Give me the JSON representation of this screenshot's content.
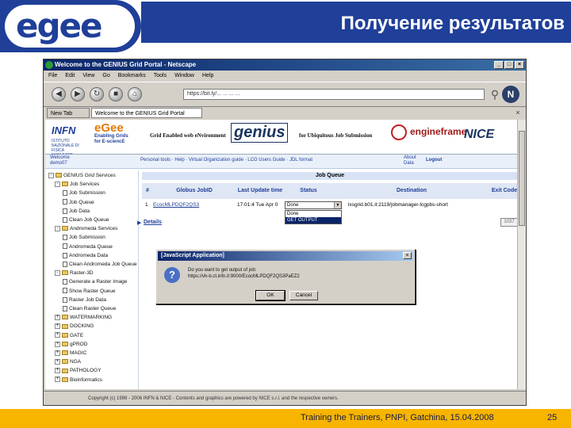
{
  "slide": {
    "logo_text": "egee",
    "title": "Получение результатов",
    "footer": "Training the Trainers, PNPI, Gatchina, 15.04.2008",
    "page_number": "25"
  },
  "browser": {
    "window_title": "Welcome to the GENIUS Grid Portal - Netscape",
    "menu": [
      "File",
      "Edit",
      "View",
      "Go",
      "Bookmarks",
      "Tools",
      "Window",
      "Help"
    ],
    "address": "https://bit.ly/... ... ... ...",
    "tabs": [
      "New Tab",
      "Welcome to the GENIUS Grid Portal"
    ],
    "status_text": "Copyright (c) 1998 - 2006 INFN & NICE - Contents and graphics are powered by NICE s.r.l. and the respective owners."
  },
  "portal": {
    "logos": {
      "infn": "INFN",
      "infn_sub": "ISTITUTO NAZIONALE DI FISICA NUCLEARE",
      "egee": "eGee",
      "egee_sub": "Enabling Grids for E-sciencE",
      "grid": "Grid Enabled web eNvironment",
      "genius": "genius",
      "portal": "for Ubiquitous Job Submission",
      "engi": "engineframe",
      "nice": "NICE"
    },
    "welcome": [
      "Welcome",
      "demo07"
    ],
    "navlinks": "Personal tools  ·  Help  ·  Virtual Organization guide  ·  LCG Users Guide  ·  JDL format",
    "about": [
      "About",
      "Data"
    ],
    "logout": "Logout",
    "tree": [
      {
        "label": "GENIUS Grid Services",
        "level": 0,
        "kind": "folder",
        "pm": "-"
      },
      {
        "label": "Job Services",
        "level": 1,
        "kind": "folder",
        "pm": "-"
      },
      {
        "label": "Job Submission",
        "level": 2,
        "kind": "doc"
      },
      {
        "label": "Job Queue",
        "level": 2,
        "kind": "doc"
      },
      {
        "label": "Job Data",
        "level": 2,
        "kind": "doc"
      },
      {
        "label": "Clean Job Queue",
        "level": 2,
        "kind": "doc"
      },
      {
        "label": "Andromeda Services",
        "level": 1,
        "kind": "folder",
        "pm": "-"
      },
      {
        "label": "Job Submission",
        "level": 2,
        "kind": "doc"
      },
      {
        "label": "Andromeda Queue",
        "level": 2,
        "kind": "doc"
      },
      {
        "label": "Andromeda Data",
        "level": 2,
        "kind": "doc"
      },
      {
        "label": "Clean Andromeda Job Queue",
        "level": 2,
        "kind": "doc"
      },
      {
        "label": "Raster-3D",
        "level": 1,
        "kind": "folder",
        "pm": "-"
      },
      {
        "label": "Generate a Raster Image",
        "level": 2,
        "kind": "doc"
      },
      {
        "label": "Show Raster Queue",
        "level": 2,
        "kind": "doc"
      },
      {
        "label": "Raster Job Data",
        "level": 2,
        "kind": "doc"
      },
      {
        "label": "Clean Raster Queue",
        "level": 2,
        "kind": "doc"
      },
      {
        "label": "WATERMARKING",
        "level": 1,
        "kind": "folder",
        "pm": "+"
      },
      {
        "label": "DOCKING",
        "level": 1,
        "kind": "folder",
        "pm": "+"
      },
      {
        "label": "GATE",
        "level": 1,
        "kind": "folder",
        "pm": "+"
      },
      {
        "label": "gPROD",
        "level": 1,
        "kind": "folder",
        "pm": "+"
      },
      {
        "label": "MAGIC",
        "level": 1,
        "kind": "folder",
        "pm": "+"
      },
      {
        "label": "NGA",
        "level": 1,
        "kind": "folder",
        "pm": "+"
      },
      {
        "label": "PATHOLOGY",
        "level": 1,
        "kind": "folder",
        "pm": "+"
      },
      {
        "label": "Bioinformatics",
        "level": 1,
        "kind": "folder",
        "pm": "+"
      }
    ],
    "queue": {
      "title": "Job Queue",
      "headers": [
        "#",
        "Globus JobID",
        "Last Update time",
        "Status",
        "Destination",
        "Exit Code"
      ],
      "row": {
        "num": "1",
        "jobid": "EcocMLPDQF2QS3",
        "time": "17:01:4 Tue Apr 0",
        "status": "Done",
        "destination": "lxsgrid.b01.it:2119/jobmanager-lcgpbs-short",
        "exit": "1037"
      },
      "status_options": [
        "Done",
        "GET OUTPUT"
      ],
      "details_link": "Details"
    },
    "dialog": {
      "title": "[JavaScript Application]",
      "message_line1": "Do you want to get output of job:",
      "message_line2": "https://vh-b.ct.infn.it:9000/EcocMLPDQF2QS3PaEZ2",
      "ok_label": "OK",
      "cancel_label": "Cancel"
    }
  },
  "colors": {
    "egee_blue": "#1f3f99",
    "footer_yellow": "#f7b500",
    "selection": "#0a246a"
  }
}
